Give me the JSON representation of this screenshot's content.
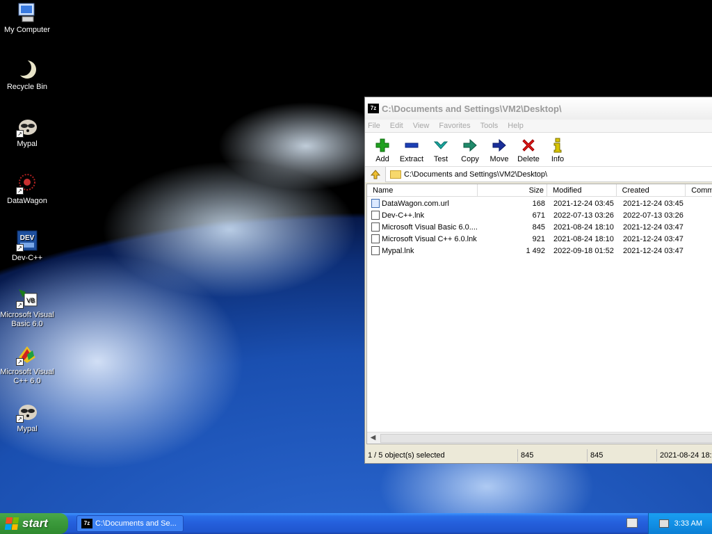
{
  "desktop": {
    "icons": [
      {
        "label": "My Computer"
      },
      {
        "label": "Recycle Bin"
      },
      {
        "label": "Mypal"
      },
      {
        "label": "DataWagon"
      },
      {
        "label": "Dev-C++"
      },
      {
        "label": "Microsoft Visual Basic 6.0"
      },
      {
        "label": "Microsoft Visual C++ 6.0"
      },
      {
        "label": "Mypal"
      }
    ]
  },
  "window": {
    "app_icon": "7z",
    "title": "C:\\Documents and Settings\\VM2\\Desktop\\",
    "menu": [
      "File",
      "Edit",
      "View",
      "Favorites",
      "Tools",
      "Help"
    ],
    "toolbar": [
      {
        "label": "Add",
        "icon": "plus-icon",
        "color": "#1fa01f"
      },
      {
        "label": "Extract",
        "icon": "minus-icon",
        "color": "#1c3fb5"
      },
      {
        "label": "Test",
        "icon": "check-icon",
        "color": "#1aa8a0"
      },
      {
        "label": "Copy",
        "icon": "arrow-right-icon",
        "color": "#1f8a6a"
      },
      {
        "label": "Move",
        "icon": "arrow-right-icon",
        "color": "#1a2f9a"
      },
      {
        "label": "Delete",
        "icon": "x-icon",
        "color": "#e01818"
      },
      {
        "label": "Info",
        "icon": "info-icon",
        "color": "#d8c400"
      }
    ],
    "address": "C:\\Documents and Settings\\VM2\\Desktop\\",
    "columns": [
      "Name",
      "Size",
      "Modified",
      "Created",
      "Comm"
    ],
    "files": [
      {
        "name": "DataWagon.com.url",
        "size": "168",
        "modified": "2021-12-24 03:45",
        "created": "2021-12-24 03:45"
      },
      {
        "name": "Dev-C++.lnk",
        "size": "671",
        "modified": "2022-07-13 03:26",
        "created": "2022-07-13 03:26"
      },
      {
        "name": "Microsoft Visual Basic 6.0....",
        "size": "845",
        "modified": "2021-08-24 18:10",
        "created": "2021-12-24 03:47"
      },
      {
        "name": "Microsoft Visual C++ 6.0.lnk",
        "size": "921",
        "modified": "2021-08-24 18:10",
        "created": "2021-12-24 03:47"
      },
      {
        "name": "Mypal.lnk",
        "size": "1 492",
        "modified": "2022-09-18 01:52",
        "created": "2021-12-24 03:47"
      }
    ],
    "status": {
      "selected": "1 / 5 object(s) selected",
      "size1": "845",
      "size2": "845",
      "date": "2021-08-24 18:"
    }
  },
  "taskbar": {
    "start_label": "start",
    "task_label": "C:\\Documents and Se...",
    "clock": "3:33 AM"
  }
}
